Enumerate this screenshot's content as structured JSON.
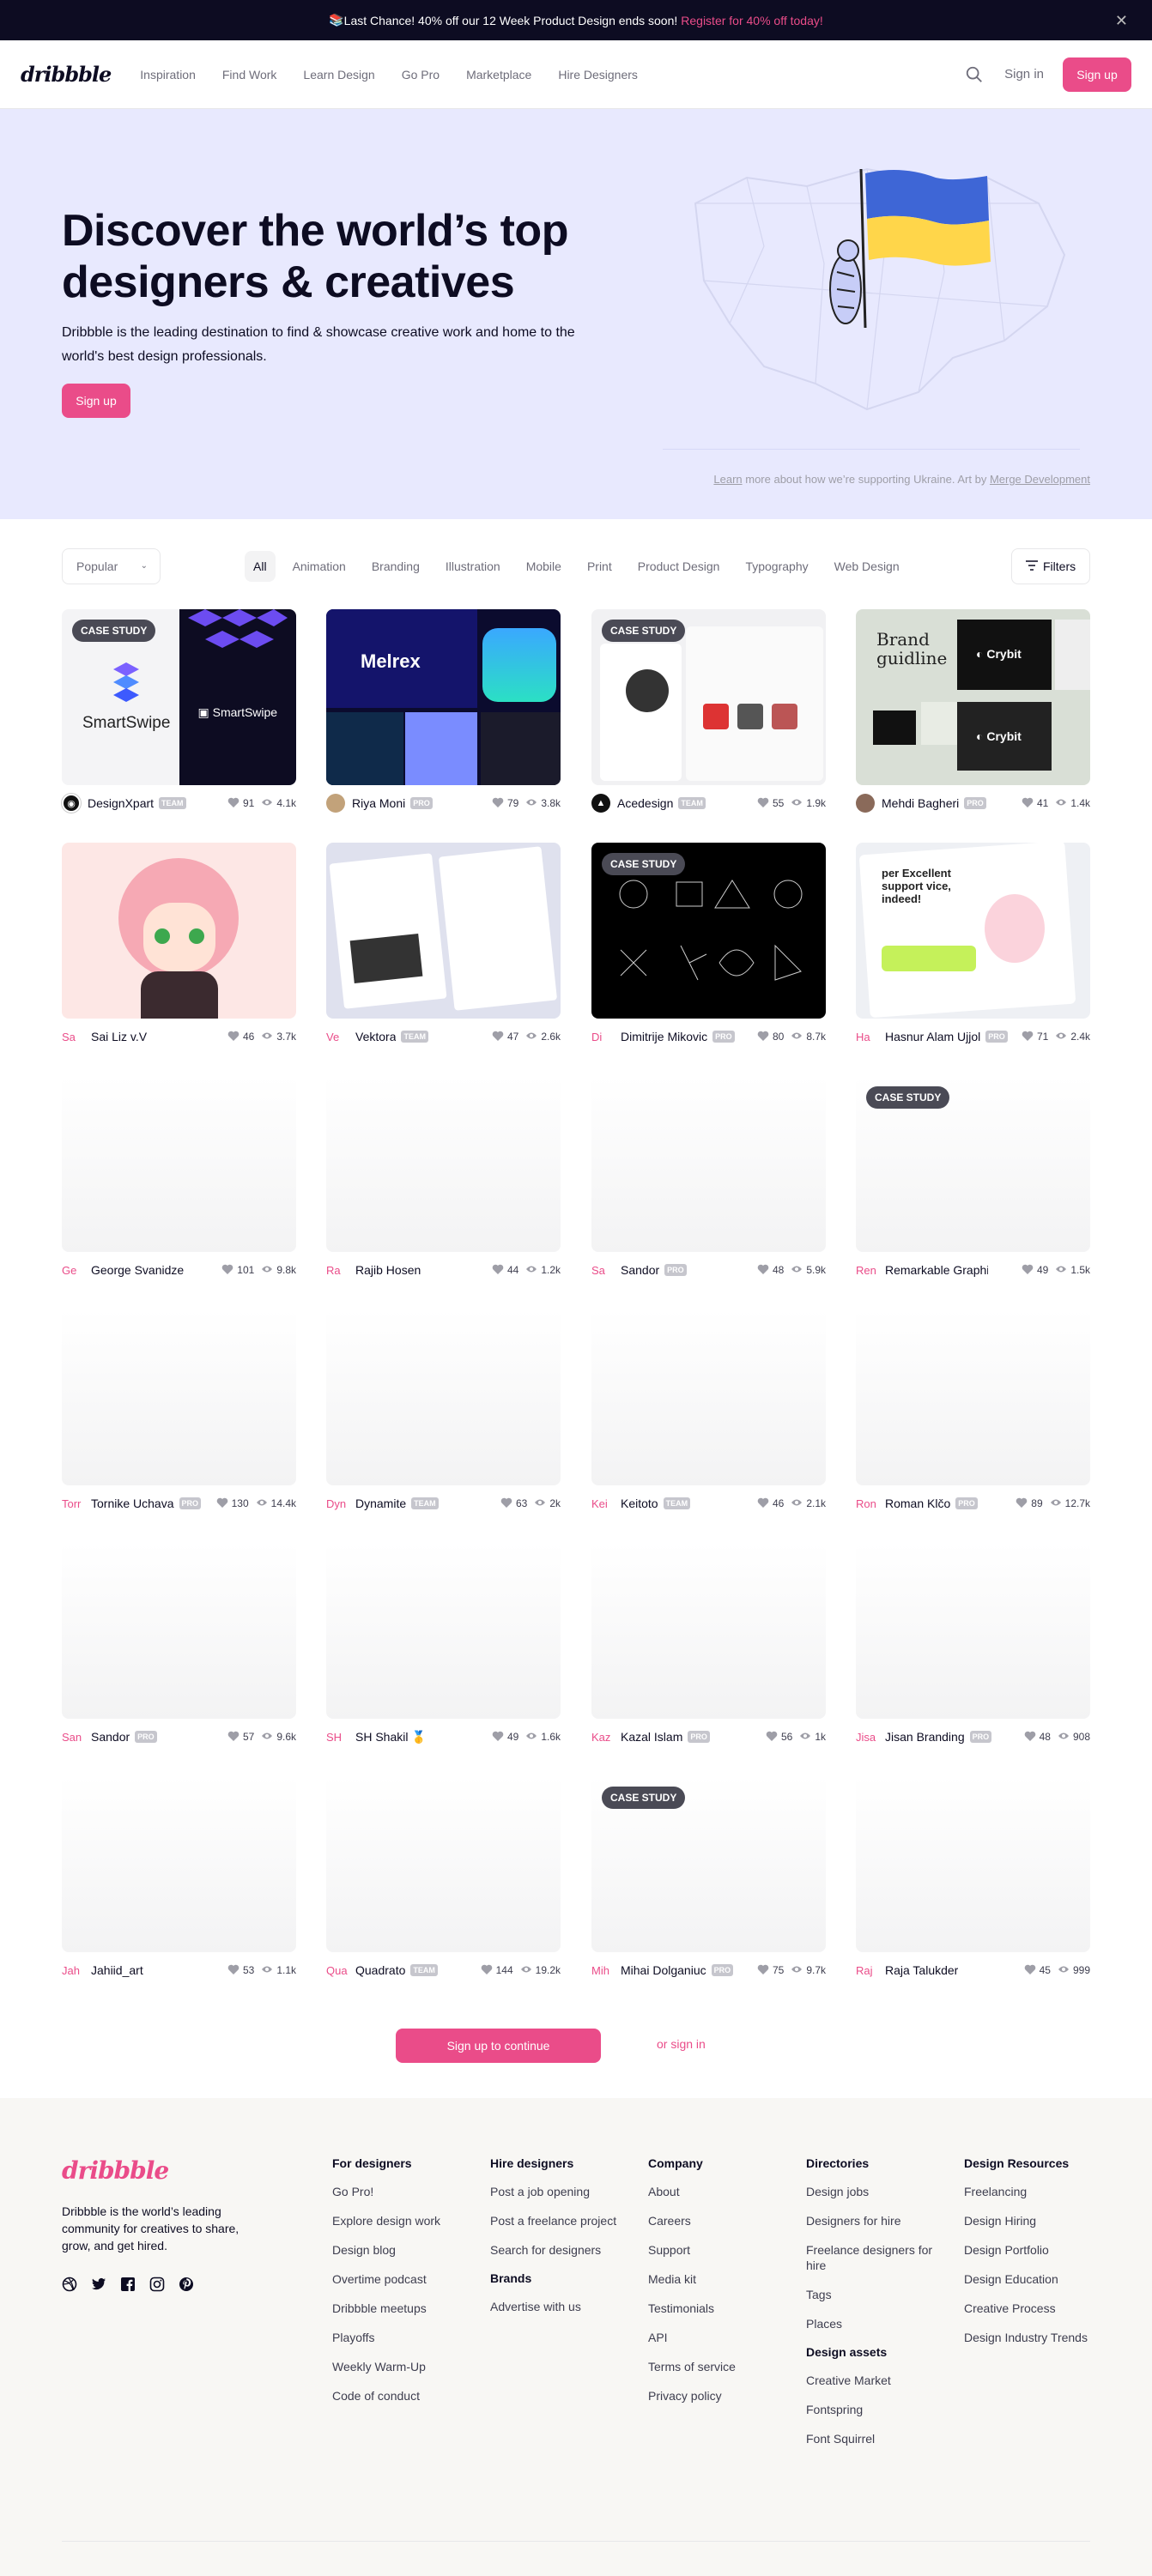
{
  "banner": {
    "icon": "book-icon",
    "text": "Last Chance! 40% off our 12 Week Product Design ends soon!",
    "link": "Register for 40% off today!"
  },
  "nav": {
    "logo": "dribbble",
    "links": [
      "Inspiration",
      "Find Work",
      "Learn Design",
      "Go Pro",
      "Marketplace",
      "Hire Designers"
    ],
    "signin": "Sign in",
    "signup": "Sign up"
  },
  "hero": {
    "title": "Discover the world’s top designers & creatives",
    "text": "Dribbble is the leading destination to find & showcase creative work and home to the world's best design professionals.",
    "signup": "Sign up",
    "credit_link1": "Learn",
    "credit_mid": " more about how we’re supporting Ukraine. Art by ",
    "credit_link2": "Merge Development"
  },
  "filters": {
    "sort": "Popular",
    "categories": [
      "All",
      "Animation",
      "Branding",
      "Illustration",
      "Mobile",
      "Print",
      "Product Design",
      "Typography",
      "Web Design"
    ],
    "filter_button": "Filters"
  },
  "shots": [
    {
      "author": "DesignXpart",
      "tag": "TEAM",
      "likes": "91",
      "views": "4.1k",
      "badge": "CASE STUDY",
      "thumb_text": "SmartSwipe"
    },
    {
      "author": "Riya Moni",
      "tag": "PRO",
      "likes": "79",
      "views": "3.8k",
      "badge": "",
      "thumb_text": "Melrex"
    },
    {
      "author": "Acedesign",
      "tag": "TEAM",
      "likes": "55",
      "views": "1.9k",
      "badge": "CASE STUDY",
      "thumb_text": ""
    },
    {
      "author": "Mehdi Bagheri",
      "tag": "PRO",
      "likes": "41",
      "views": "1.4k",
      "badge": "",
      "thumb_text": "Brand guidline"
    },
    {
      "author": "Sai Liz v.V",
      "tag": "",
      "likes": "46",
      "views": "3.7k",
      "badge": "",
      "thumb_text": "",
      "initials": "Sa"
    },
    {
      "author": "Vektora",
      "tag": "TEAM",
      "likes": "47",
      "views": "2.6k",
      "badge": "",
      "thumb_text": "",
      "initials": "Ve"
    },
    {
      "author": "Dimitrije Mikovic",
      "tag": "PRO",
      "likes": "80",
      "views": "8.7k",
      "badge": "CASE STUDY",
      "thumb_text": "",
      "initials": "Di"
    },
    {
      "author": "Hasnur Alam Ujjol",
      "tag": "PRO",
      "likes": "71",
      "views": "2.4k",
      "badge": "",
      "thumb_text": "per Excellent support vice, indeed!",
      "initials": "Ha"
    },
    {
      "author": "George Svanidze",
      "tag": "",
      "likes": "101",
      "views": "9.8k",
      "badge": "",
      "initials": "Ge"
    },
    {
      "author": "Rajib Hosen",
      "tag": "",
      "likes": "44",
      "views": "1.2k",
      "badge": "",
      "initials": "Ra"
    },
    {
      "author": "Sandor",
      "tag": "PRO",
      "likes": "48",
      "views": "5.9k",
      "badge": "",
      "initials": "Sa"
    },
    {
      "author": "Remarkable Graphic",
      "tag": "",
      "likes": "49",
      "views": "1.5k",
      "badge": "CASE STUDY",
      "initials": "Ren"
    },
    {
      "author": "Tornike Uchava",
      "tag": "PRO",
      "likes": "130",
      "views": "14.4k",
      "badge": "",
      "initials": "Torr"
    },
    {
      "author": "Dynamite",
      "tag": "TEAM",
      "likes": "63",
      "views": "2k",
      "badge": "",
      "initials": "Dyn"
    },
    {
      "author": "Keitoto",
      "tag": "TEAM",
      "likes": "46",
      "views": "2.1k",
      "badge": "",
      "initials": "Kei"
    },
    {
      "author": "Roman Klčo",
      "tag": "PRO",
      "likes": "89",
      "views": "12.7k",
      "badge": "",
      "initials": "Ron"
    },
    {
      "author": "Sandor",
      "tag": "PRO",
      "likes": "57",
      "views": "9.6k",
      "badge": "",
      "initials": "San"
    },
    {
      "author": "SH Shakil 🥇",
      "tag": "",
      "likes": "49",
      "views": "1.6k",
      "badge": "",
      "initials": "SH"
    },
    {
      "author": "Kazal Islam",
      "tag": "PRO",
      "likes": "56",
      "views": "1k",
      "badge": "",
      "initials": "Kaz"
    },
    {
      "author": "Jisan Branding",
      "tag": "PRO",
      "likes": "48",
      "views": "908",
      "badge": "",
      "initials": "Jisa"
    },
    {
      "author": "Jahiid_art",
      "tag": "",
      "likes": "53",
      "views": "1.1k",
      "badge": "",
      "initials": "Jah"
    },
    {
      "author": "Quadrato",
      "tag": "TEAM",
      "likes": "144",
      "views": "19.2k",
      "badge": "",
      "initials": "Qua"
    },
    {
      "author": "Mihai Dolganiuc",
      "tag": "PRO",
      "likes": "75",
      "views": "9.7k",
      "badge": "CASE STUDY",
      "initials": "Mih"
    },
    {
      "author": "Raja Talukder",
      "tag": "",
      "likes": "45",
      "views": "999",
      "badge": "",
      "initials": "Raj"
    }
  ],
  "cta": {
    "button": "Sign up to continue",
    "or": "or sign in"
  },
  "footer": {
    "logo": "dribbble",
    "desc": "Dribbble is the world’s leading community for creatives to share, grow, and get hired.",
    "social": [
      "dribbble-icon",
      "twitter-icon",
      "facebook-icon",
      "instagram-icon",
      "pinterest-icon"
    ],
    "cols": [
      {
        "title": "For designers",
        "items": [
          "Go Pro!",
          "Explore design work",
          "Design blog",
          "Overtime podcast",
          "Dribbble meetups",
          "Playoffs",
          "Weekly Warm-Up",
          "Code of conduct"
        ]
      },
      {
        "title": "Hire designers",
        "items": [
          "Post a job opening",
          "Post a freelance project",
          "Search for designers"
        ],
        "sub_title": "Brands",
        "sub_items": [
          "Advertise with us"
        ]
      },
      {
        "title": "Company",
        "items": [
          "About",
          "Careers",
          "Support",
          "Media kit",
          "Testimonials",
          "API",
          "Terms of service",
          "Privacy policy"
        ]
      },
      {
        "title": "Directories",
        "items": [
          "Design jobs",
          "Designers for hire",
          "Freelance designers for hire",
          "Tags",
          "Places"
        ],
        "sub_title": "Design assets",
        "sub_items": [
          "Creative Market",
          "Fontspring",
          "Font Squirrel"
        ]
      },
      {
        "title": "Design Resources",
        "items": [
          "Freelancing",
          "Design Hiring",
          "Design Portfolio",
          "Design Education",
          "Creative Process",
          "Design Industry Trends"
        ]
      }
    ]
  },
  "colors": {
    "brand": "#ea4c89",
    "dark": "#0d0c22",
    "hero_bg": "#e8e9fe"
  }
}
